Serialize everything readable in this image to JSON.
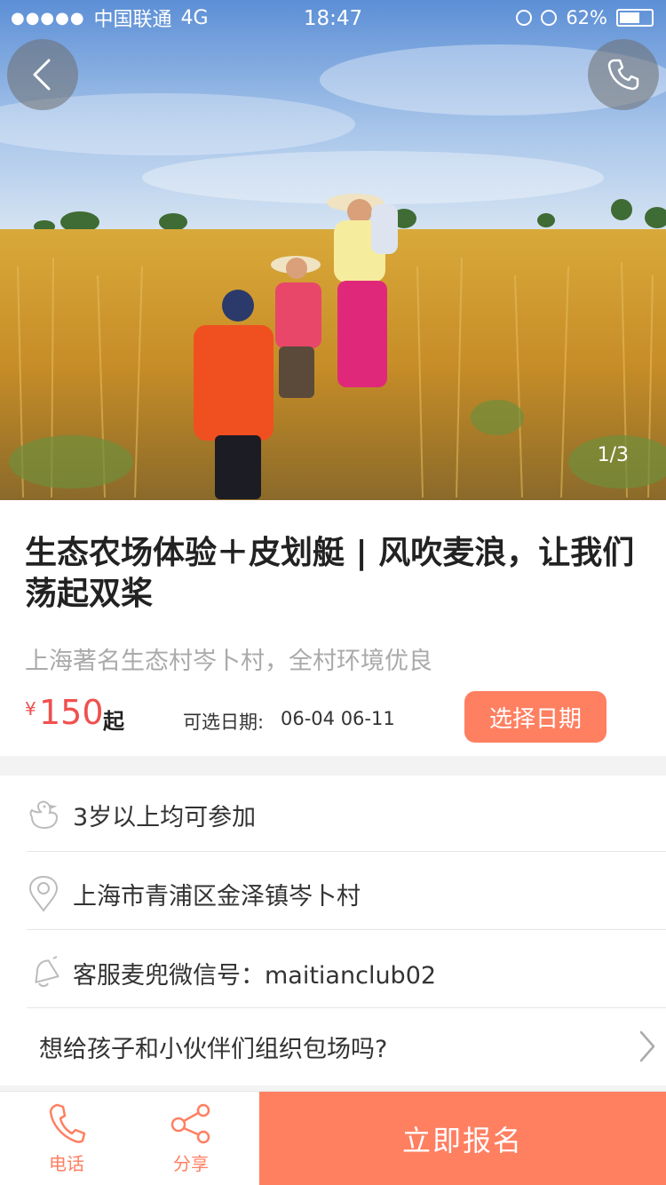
{
  "status_bar": {
    "carrier": "中国联通",
    "network": "4G",
    "time": "18:47",
    "battery": "62%"
  },
  "hero": {
    "page_counter": "1/3"
  },
  "activity": {
    "title": "生态农场体验＋皮划艇 | 风吹麦浪，让我们荡起双桨",
    "subtitle": "上海著名生态村岑卜村，全村环境优良",
    "price_currency": "¥",
    "price_value": "150",
    "price_suffix": "起",
    "date_label": "可选日期:",
    "date_value": "06-04  06-11",
    "date_button": "选择日期"
  },
  "details": [
    {
      "icon": "duck-icon",
      "text": "3岁以上均可参加"
    },
    {
      "icon": "location-pin-icon",
      "text": "上海市青浦区金泽镇岑卜村"
    },
    {
      "icon": "bell-icon",
      "text": "客服麦兜微信号：maitianclub02"
    },
    {
      "icon": "chevron-right-icon",
      "text": "想给孩子和小伙伴们组织包场吗?"
    }
  ],
  "bottom_bar": {
    "phone_label": "电话",
    "share_label": "分享",
    "register_label": "立即报名"
  },
  "colors": {
    "accent": "#ff7f61",
    "price": "#f0504f"
  }
}
